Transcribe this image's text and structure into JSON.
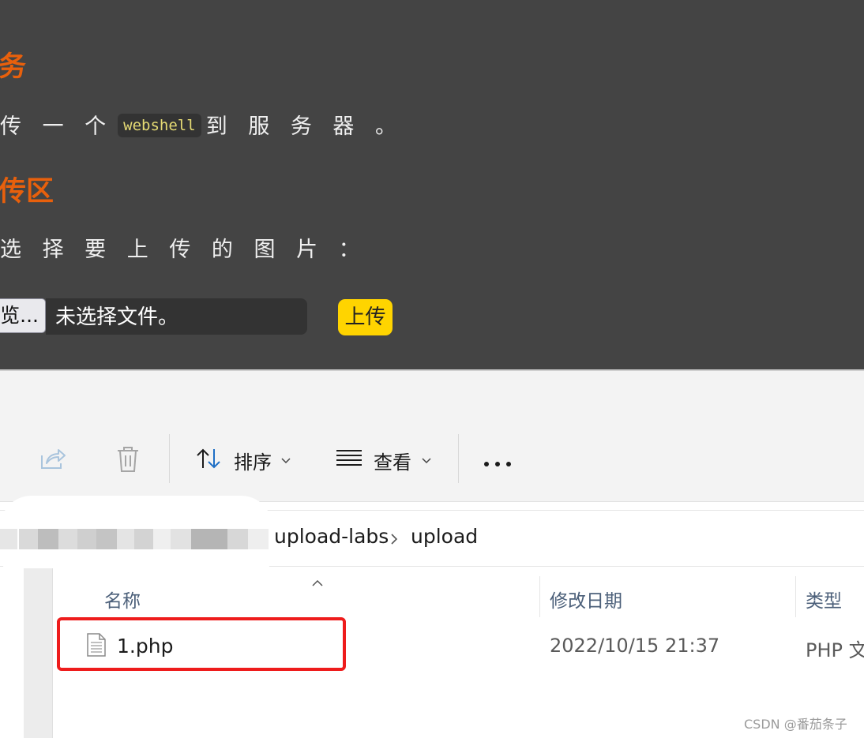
{
  "web": {
    "task_heading": "务",
    "task_text_before": "传 一 个",
    "task_code": "webshell",
    "task_text_after": "到 服 务 器 。",
    "upload_heading": "传区",
    "prompt_text": "选 择 要 上 传 的 图 片 ：",
    "browse_label": "览...",
    "file_status": "未选择文件。",
    "upload_button": "上传",
    "colors": {
      "heading": "#e8600c",
      "background": "#444444",
      "upload_button": "#ffd400"
    }
  },
  "explorer": {
    "toolbar": {
      "share_icon": "share-icon",
      "delete_icon": "trash-icon",
      "sort_label": "排序",
      "view_label": "查看",
      "more_icon": "more-icon"
    },
    "breadcrumb": [
      "upload-labs",
      "upload"
    ],
    "columns": {
      "name": "名称",
      "modified": "修改日期",
      "type": "类型"
    },
    "files": [
      {
        "name": "1.php",
        "modified": "2022/10/15 21:37",
        "type": "PHP 文"
      }
    ]
  },
  "watermark": "CSDN @番茄条子"
}
